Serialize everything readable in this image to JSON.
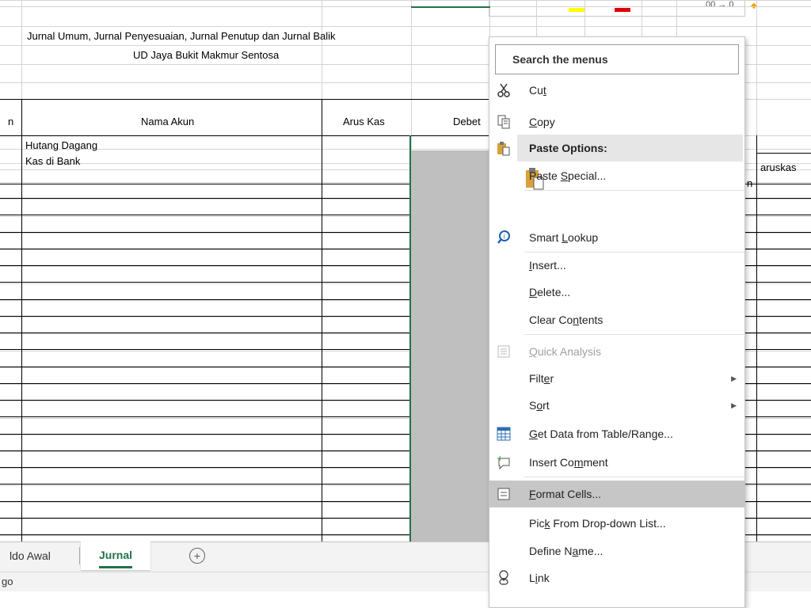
{
  "sheet": {
    "title_line1": "Jurnal Umum, Jurnal Penyesuaian, Jurnal Penutup dan Jurnal Balik",
    "title_line2": "UD Jaya Bukit Makmur Sentosa",
    "headers": {
      "col_a_partial": "n",
      "nama_akun": "Nama Akun",
      "arus_kas": "Arus Kas",
      "debet_partial": "Debet"
    },
    "right_partial_1": "aruskas",
    "right_partial_2": "n",
    "rows": [
      "Hutang Dagang",
      "Kas di Bank"
    ]
  },
  "ribbon_fragment": {
    "number_format_text": ".00 →.0"
  },
  "tabs": {
    "prev_partial": "ldo Awal",
    "active": "Jurnal",
    "add_symbol": "+"
  },
  "status": {
    "left_partial": "go"
  },
  "context_menu": {
    "search_label": "Search the menus",
    "items": [
      {
        "pre": "Cu",
        "acc": "t",
        "post": "",
        "icon": "scissors-icon"
      },
      {
        "pre": "",
        "acc": "C",
        "post": "opy",
        "icon": "copy-icon"
      },
      {
        "pre": "Paste Options:",
        "acc": "",
        "post": "",
        "icon": "clipboard-icon"
      },
      {
        "pre": "Paste ",
        "acc": "S",
        "post": "pecial...",
        "icon": ""
      },
      {
        "pre": "Smart ",
        "acc": "L",
        "post": "ookup",
        "icon": "smart-lookup-icon"
      },
      {
        "pre": "",
        "acc": "I",
        "post": "nsert...",
        "icon": ""
      },
      {
        "pre": "",
        "acc": "D",
        "post": "elete...",
        "icon": ""
      },
      {
        "pre": "Clear Co",
        "acc": "n",
        "post": "tents",
        "icon": ""
      },
      {
        "pre": "",
        "acc": "Q",
        "post": "uick Analysis",
        "icon": "quick-analysis-icon"
      },
      {
        "pre": "Filt",
        "acc": "e",
        "post": "r",
        "icon": ""
      },
      {
        "pre": "S",
        "acc": "o",
        "post": "rt",
        "icon": ""
      },
      {
        "pre": "",
        "acc": "G",
        "post": "et Data from Table/Range...",
        "icon": "table-icon"
      },
      {
        "pre": "Insert Co",
        "acc": "m",
        "post": "ment",
        "icon": "comment-icon"
      },
      {
        "pre": "",
        "acc": "F",
        "post": "ormat Cells...",
        "icon": "format-cells-icon"
      },
      {
        "pre": "Pic",
        "acc": "k",
        "post": " From Drop-down List...",
        "icon": ""
      },
      {
        "pre": "Define N",
        "acc": "a",
        "post": "me...",
        "icon": ""
      },
      {
        "pre": "L",
        "acc": "i",
        "post": "nk",
        "icon": "link-icon"
      }
    ]
  },
  "colors": {
    "accent_green": "#217346",
    "highlight": "#c6c6c6",
    "selection_gray": "#bfbfbf"
  }
}
